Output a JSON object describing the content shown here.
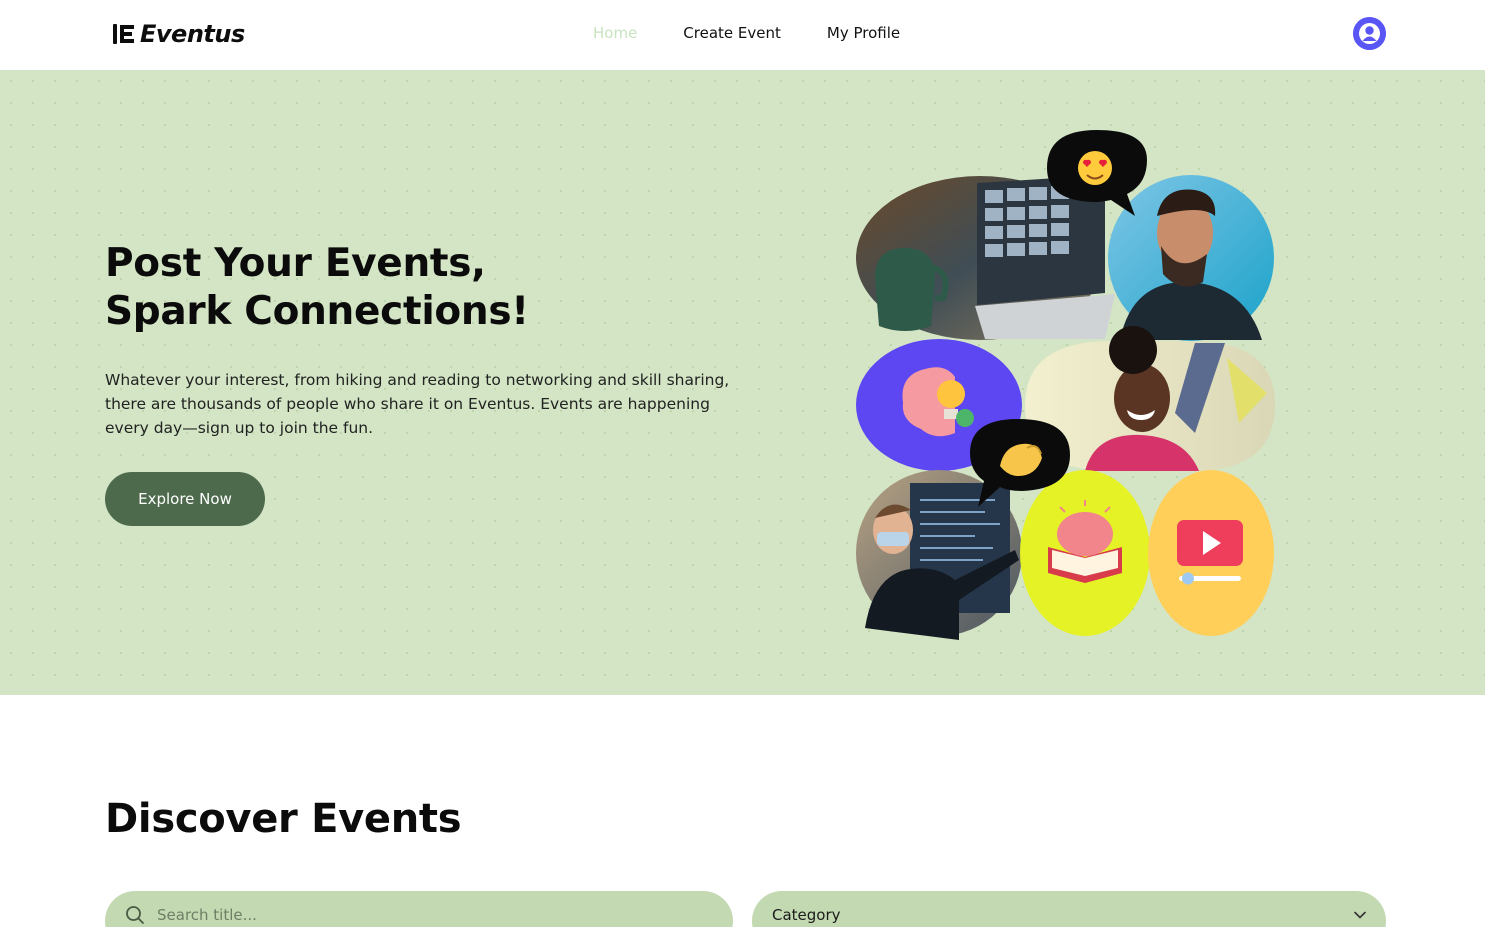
{
  "brand": {
    "name": "Eventus"
  },
  "nav": {
    "items": [
      {
        "label": "Home",
        "active": true
      },
      {
        "label": "Create Event",
        "active": false
      },
      {
        "label": "My Profile",
        "active": false
      }
    ]
  },
  "hero": {
    "title_line1": "Post Your Events,",
    "title_line2": "Spark Connections!",
    "description": "Whatever your interest, from hiking and reading to networking and skill sharing, there are thousands of people who share it on Eventus. Events are happening every day—sign up to join the fun.",
    "cta_label": "Explore Now"
  },
  "discover": {
    "title": "Discover Events",
    "search_placeholder": "Search title...",
    "category_label": "Category"
  },
  "colors": {
    "hero_bg": "#d3e5c4",
    "accent": "#4d6a4c",
    "nav_active": "#c8e3c0",
    "field_bg": "#c2d9b1",
    "avatar": "#5a55f5"
  },
  "collage": {
    "tiles": [
      "laptop-video-call-photo",
      "laughing-man-photo",
      "brain-idea-icon",
      "smiling-woman-photo",
      "presenter-photo",
      "brain-book-icon",
      "video-player-icon"
    ],
    "bubbles": [
      "heart-eyes-emoji",
      "pinched-fingers-emoji"
    ]
  }
}
